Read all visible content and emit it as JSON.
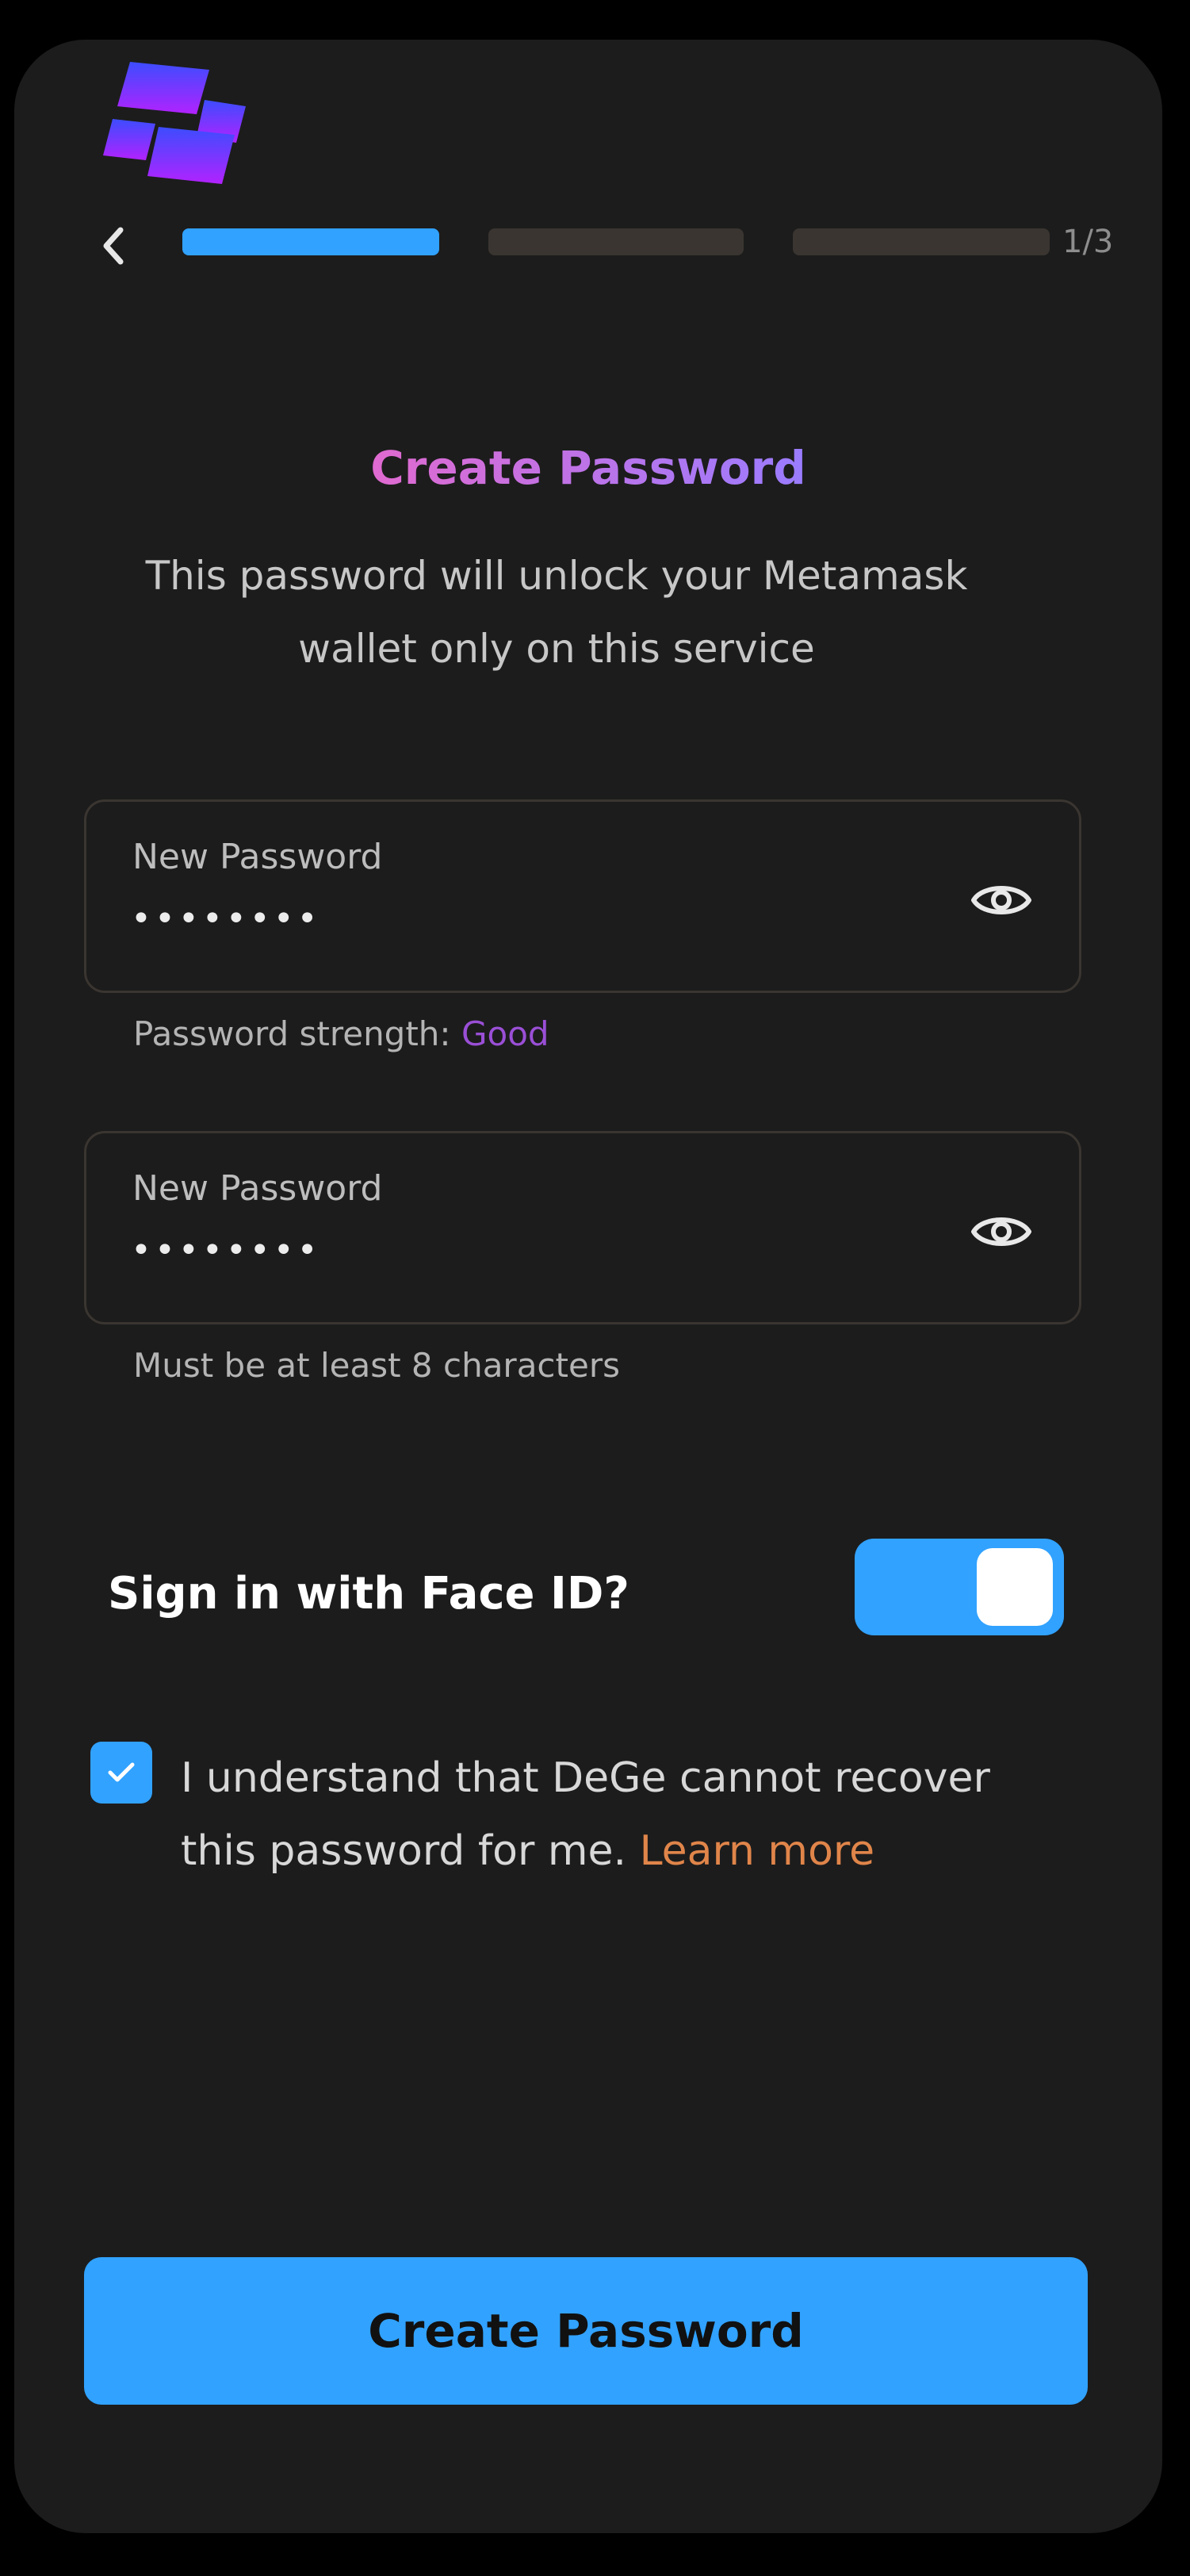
{
  "colors": {
    "accent": "#31a2ff",
    "progress_inactive": "#3a3530",
    "title_gradient_start": "#e06ad0",
    "title_gradient_end": "#9a7cff",
    "strength_good": "#9a4fd6",
    "learn_more": "#e0854a",
    "logo_top": "#3c4dff",
    "logo_bottom": "#b222ff"
  },
  "header": {
    "back_icon": "chevron-left-icon",
    "step_count": "1/3",
    "progress": {
      "current_step": 1,
      "total_steps": 3
    }
  },
  "main": {
    "title": "Create Password",
    "subtitle": "This password will unlock your Metamask wallet only on this service"
  },
  "fields": [
    {
      "label": "New Password",
      "value": "••••••••",
      "icon": "eye-icon"
    },
    {
      "label": "New Password",
      "value": "••••••••",
      "icon": "eye-icon"
    }
  ],
  "password_strength": {
    "label": "Password strength:",
    "value": "Good"
  },
  "requirement_hint": "Must be at least 8 characters",
  "face_id": {
    "label": "Sign in with Face ID?",
    "enabled": true
  },
  "consent": {
    "checked": true,
    "text": "I understand that DeGe cannot recover this password for me.",
    "link_text": "Learn more"
  },
  "cta": {
    "label": "Create Password"
  }
}
